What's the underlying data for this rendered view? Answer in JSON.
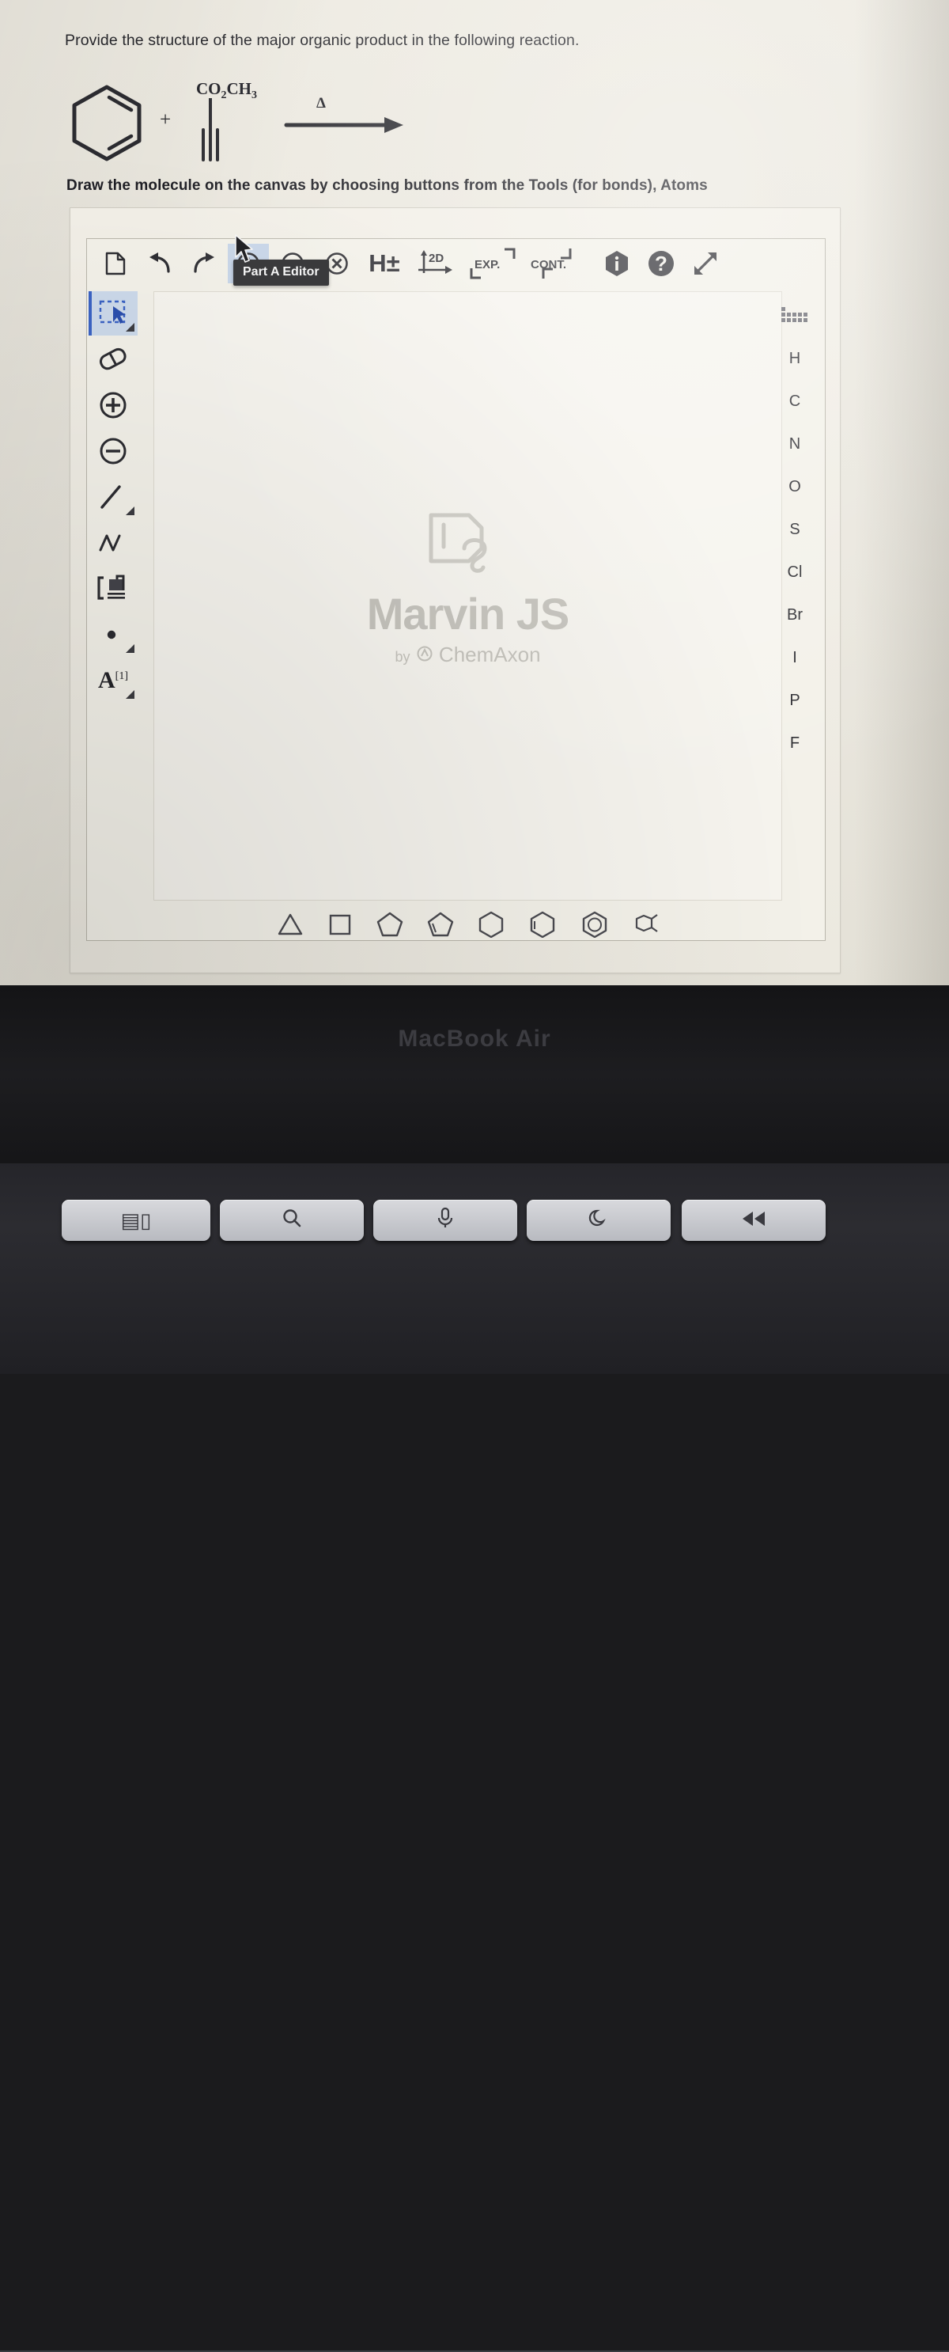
{
  "question": {
    "prompt": "Provide the structure of the major organic product in the following reaction.",
    "instruction": "Draw the molecule on the canvas by choosing buttons from the Tools (for bonds), Atoms"
  },
  "reaction": {
    "reagent_label": "CO2CH3",
    "reagent_label_parts": {
      "co": "CO",
      "sub2": "2",
      "ch": "CH",
      "sub3": "3"
    },
    "plus": "+",
    "conditions": "Δ",
    "diene_name": "1,3-cyclohexadiene",
    "dienophile_name": "methyl propiolate"
  },
  "tooltip": {
    "text": "Part A Editor"
  },
  "toolbar": {
    "items": [
      {
        "name": "new-document",
        "label": "",
        "icon": "document-icon",
        "active": false
      },
      {
        "name": "undo",
        "label": "",
        "icon": "undo-arrow-icon",
        "active": false
      },
      {
        "name": "redo",
        "label": "",
        "icon": "redo-arrow-icon",
        "active": false
      },
      {
        "name": "zoom-in",
        "label": "",
        "icon": "plus-circle-icon",
        "active": true
      },
      {
        "name": "zoom-out",
        "label": "",
        "icon": "minus-circle-icon",
        "active": false
      },
      {
        "name": "clear-canvas",
        "label": "",
        "icon": "x-circle-icon",
        "active": false
      },
      {
        "name": "add-remove-hydrogens",
        "label": "H±",
        "icon": "h-plus-minus-icon",
        "active": false
      },
      {
        "name": "clean-2d",
        "label": "2D",
        "icon": "clean-2d-icon",
        "active": false
      },
      {
        "name": "expand-groups",
        "label": "EXP.",
        "icon": "expand-icon",
        "active": false
      },
      {
        "name": "contract-groups",
        "label": "CONT.",
        "icon": "contract-icon",
        "active": false
      },
      {
        "name": "information",
        "label": "i",
        "icon": "info-hexagon-icon",
        "active": false
      },
      {
        "name": "help",
        "label": "?",
        "icon": "question-circle-icon",
        "active": false
      },
      {
        "name": "fullscreen",
        "label": "",
        "icon": "expand-arrows-icon",
        "active": false
      }
    ]
  },
  "tools_rail": {
    "items": [
      {
        "name": "selection-tool",
        "icon": "marquee-select-icon",
        "selected": true,
        "has_dropdown": true
      },
      {
        "name": "eraser-tool",
        "icon": "eraser-icon",
        "selected": false,
        "has_dropdown": false
      },
      {
        "name": "increase-charge-tool",
        "icon": "plus-circle-icon",
        "selected": false,
        "has_dropdown": false
      },
      {
        "name": "decrease-charge-tool",
        "icon": "minus-circle-icon",
        "selected": false,
        "has_dropdown": false
      },
      {
        "name": "single-bond-tool",
        "icon": "single-bond-icon",
        "selected": false,
        "has_dropdown": true
      },
      {
        "name": "chain-tool",
        "icon": "zigzag-chain-icon",
        "selected": false,
        "has_dropdown": false
      },
      {
        "name": "bracket-tool",
        "icon": "bracket-group-icon",
        "selected": false,
        "has_dropdown": false
      },
      {
        "name": "lone-pair-tool",
        "icon": "dot-icon",
        "selected": false,
        "has_dropdown": true
      },
      {
        "name": "atom-label-tool",
        "icon": "atom-label-icon",
        "selected": false,
        "has_dropdown": true,
        "label": "A",
        "superscript": "[1]"
      }
    ]
  },
  "elements_panel": {
    "periodic_table_label": "",
    "items": [
      "H",
      "C",
      "N",
      "O",
      "S",
      "Cl",
      "Br",
      "I",
      "P",
      "F"
    ]
  },
  "ring_templates": [
    {
      "name": "cyclopropane-template",
      "sides": 3
    },
    {
      "name": "cyclobutane-template",
      "sides": 4
    },
    {
      "name": "cyclopentane-template",
      "sides": 5
    },
    {
      "name": "cyclopentadiene-template",
      "sides": 5
    },
    {
      "name": "cyclohexane-template",
      "sides": 6
    },
    {
      "name": "cyclohexene-template",
      "sides": 6
    },
    {
      "name": "benzene-template",
      "sides": 6
    },
    {
      "name": "custom-template",
      "sides": 0
    }
  ],
  "canvas": {
    "watermark_title": "Marvin JS",
    "watermark_by": "by",
    "watermark_vendor": "ChemAxon"
  },
  "device": {
    "brand_label": "MacBook Air",
    "keys": [
      {
        "name": "mission-control-key",
        "glyph": "▤▯"
      },
      {
        "name": "spotlight-search-key",
        "glyph": "◯"
      },
      {
        "name": "dictation-key",
        "glyph": "🎙"
      },
      {
        "name": "do-not-disturb-key",
        "glyph": "☾"
      },
      {
        "name": "previous-track-key",
        "glyph": "◀◀"
      }
    ]
  },
  "colors": {
    "accent": "#3b63c4",
    "selected_bg": "#ccd9ea",
    "tooltip_bg": "#3a3a3c",
    "paper": "#eae7de",
    "ink": "#26262b"
  }
}
